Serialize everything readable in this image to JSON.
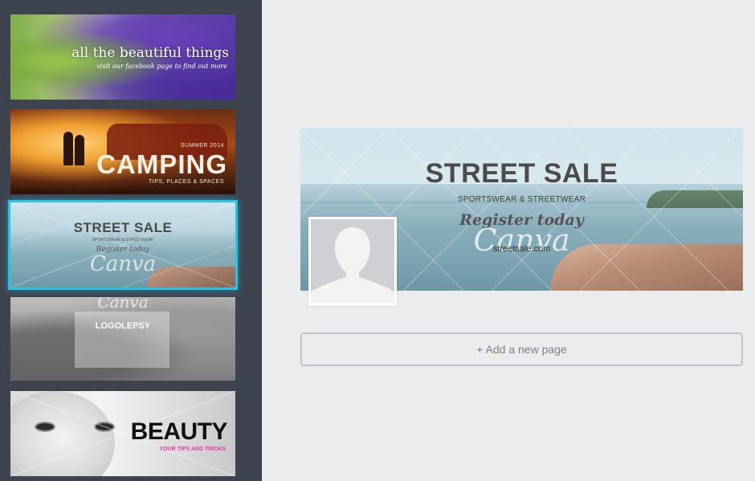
{
  "sidebar": {
    "templates": [
      {
        "title": "all the beautiful things",
        "subtitle": "visit our facebook page to find out more"
      },
      {
        "kicker": "SUMMER 2014",
        "title": "CAMPING",
        "subtitle": "TIPS, PLACES & SPACES"
      },
      {
        "title": "STREET SALE",
        "subtitle": "SPORTSWEAR & STREETWEAR",
        "tagline": "Register today",
        "watermark": "Canva",
        "selected": true
      },
      {
        "title": "LOGOLEPSY",
        "watermark": "Canva"
      },
      {
        "title": "BEAUTY",
        "subtitle": "YOUR TIPS AND TRICKS"
      }
    ]
  },
  "cover": {
    "title": "STREET SALE",
    "subtitle": "SPORTSWEAR & STREETWEAR",
    "tagline": "Register today",
    "url": "streetsale.com",
    "watermark": "Canva"
  },
  "add_page": {
    "label": "+ Add a new page"
  },
  "colors": {
    "sidebar_bg": "#3d4450",
    "canvas_bg": "#ebecee",
    "selection": "#24c3e8",
    "accent_pink": "#e83aa8"
  }
}
